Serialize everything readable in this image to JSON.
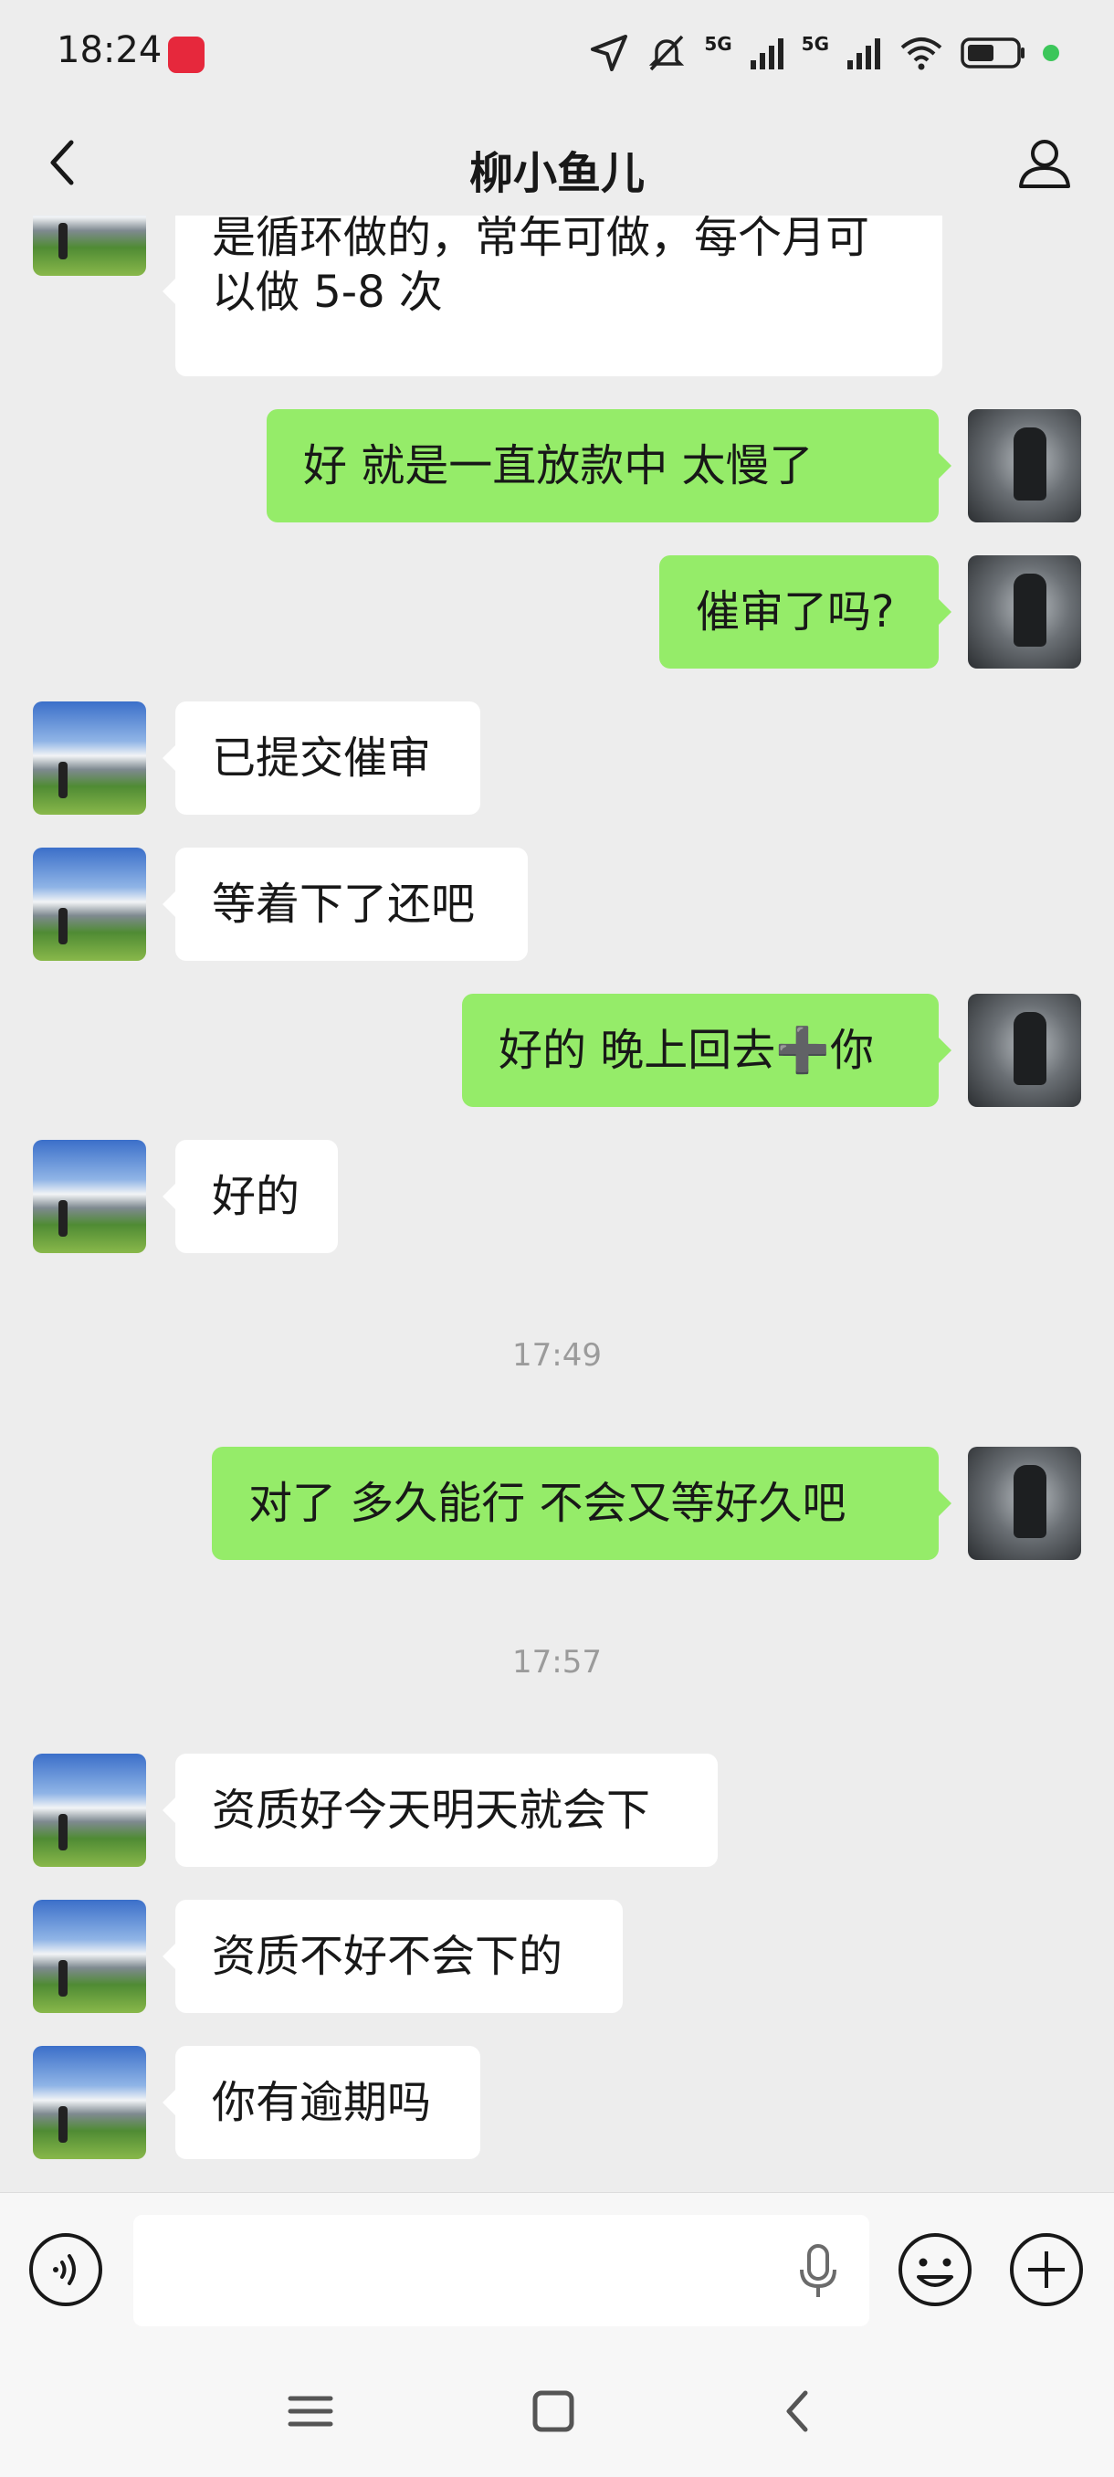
{
  "status_bar": {
    "time": "18:24",
    "network_1": "5G",
    "network_2": "5G"
  },
  "header": {
    "title": "柳小鱼儿"
  },
  "messages": [
    {
      "side": "in",
      "text": "是循环做的，常年可做，每个月可以做 5-8 次"
    },
    {
      "side": "out",
      "text": "好   就是一直放款中 太慢了"
    },
    {
      "side": "out",
      "text": "催审了吗?"
    },
    {
      "side": "in",
      "text": "已提交催审"
    },
    {
      "side": "in",
      "text": "等着下了还吧"
    },
    {
      "side": "out",
      "text": "好的 晚上回去➕你"
    },
    {
      "side": "in",
      "text": "好的"
    },
    {
      "type": "time",
      "text": "17:49"
    },
    {
      "side": "out",
      "text": "对了 多久能行  不会又等好久吧"
    },
    {
      "type": "time",
      "text": "17:57"
    },
    {
      "side": "in",
      "text": "资质好今天明天就会下"
    },
    {
      "side": "in",
      "text": "资质不好不会下的"
    },
    {
      "side": "in",
      "text": "你有逾期吗"
    }
  ],
  "colors": {
    "outgoing_bubble": "#95ec69",
    "incoming_bubble": "#ffffff",
    "background": "#ededed"
  },
  "input": {
    "value": "",
    "placeholder": ""
  }
}
